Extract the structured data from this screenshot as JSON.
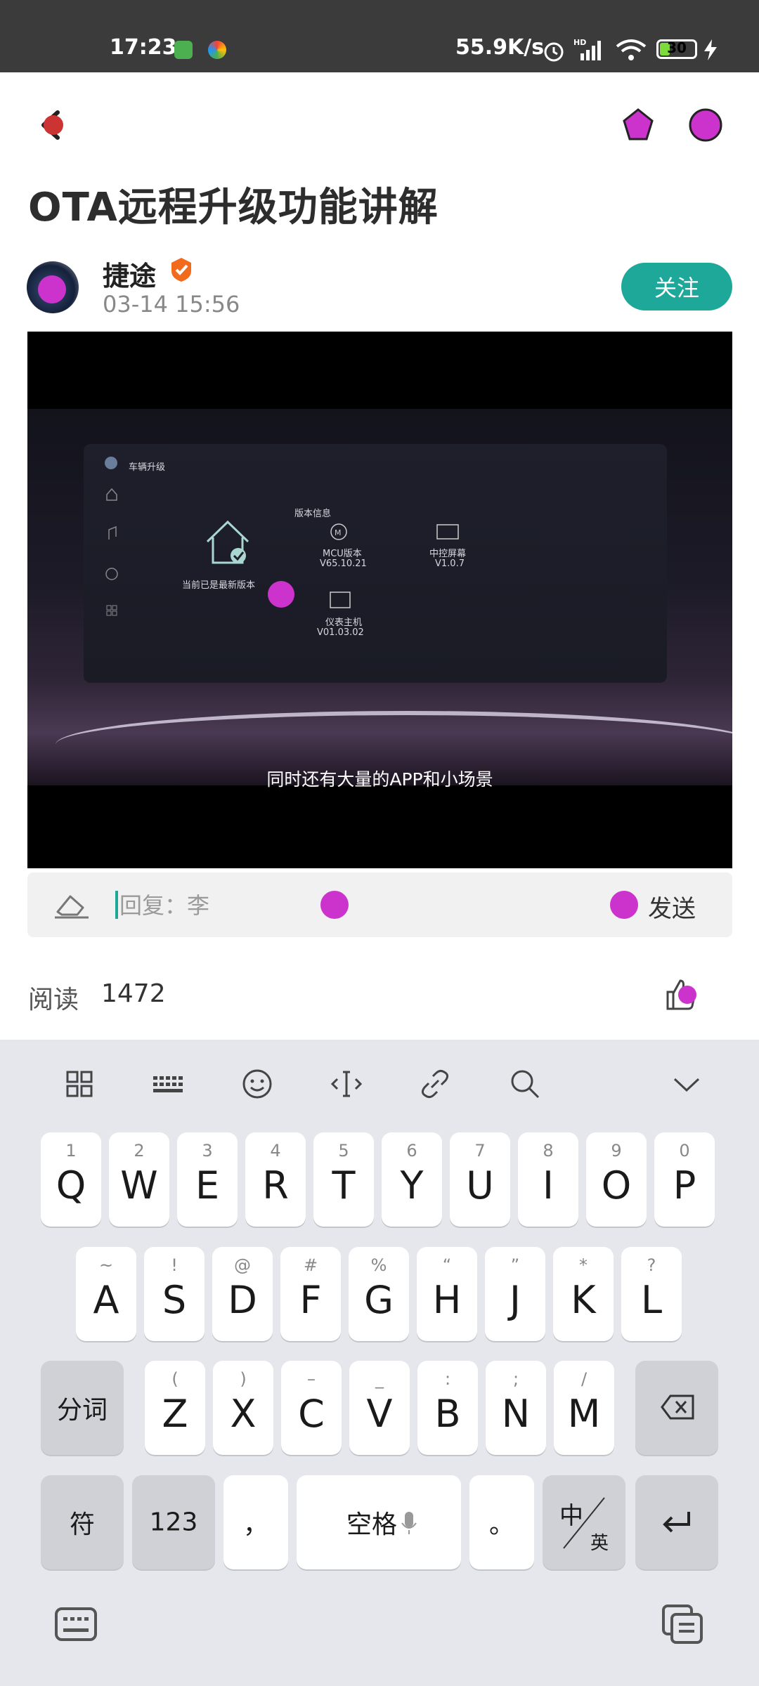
{
  "status_bar": {
    "time": "17:23",
    "network_speed": "55.9K/s",
    "battery": "30",
    "battery_level": 0.3,
    "icons": [
      "app-notification-icon",
      "app-colorful-icon",
      "alarm-icon",
      "hd-signal-icon",
      "wifi-icon",
      "battery-icon",
      "charging-icon"
    ]
  },
  "header": {
    "back_icon": "back-arrow-icon",
    "share_icon": "share-icon",
    "more_icon": "more-icon"
  },
  "article": {
    "title": "OTA远程升级功能讲解",
    "author": "捷途",
    "post_time": "03-14 15:56",
    "follow_label": "关注"
  },
  "video": {
    "subtitle": "同时还有大量的APP和小场景",
    "screen": {
      "header": "车辆升级",
      "version_title": "版本信息",
      "status": "当前已是最新版本",
      "mcu_label": "MCU版本",
      "mcu_version": "V65.10.21",
      "center_label": "中控屏幕",
      "center_version": "V1.0.7",
      "cluster_label": "仪表主机",
      "cluster_version": "V01.03.02"
    }
  },
  "reply": {
    "placeholder": "回复：李",
    "send_label": "发送"
  },
  "stats": {
    "read_label": "阅读",
    "read_count": "1472"
  },
  "keyboard": {
    "toolbar": [
      "grid-apps-icon",
      "keyboard-layout-icon",
      "emoji-icon",
      "cursor-move-icon",
      "link-icon",
      "search-icon",
      "collapse-chevron-icon"
    ],
    "row1": [
      {
        "main": "Q",
        "sub": "1"
      },
      {
        "main": "W",
        "sub": "2"
      },
      {
        "main": "E",
        "sub": "3"
      },
      {
        "main": "R",
        "sub": "4"
      },
      {
        "main": "T",
        "sub": "5"
      },
      {
        "main": "Y",
        "sub": "6"
      },
      {
        "main": "U",
        "sub": "7"
      },
      {
        "main": "I",
        "sub": "8"
      },
      {
        "main": "O",
        "sub": "9"
      },
      {
        "main": "P",
        "sub": "0"
      }
    ],
    "row2": [
      {
        "main": "A",
        "sub": "~"
      },
      {
        "main": "S",
        "sub": "!"
      },
      {
        "main": "D",
        "sub": "@"
      },
      {
        "main": "F",
        "sub": "#"
      },
      {
        "main": "G",
        "sub": "%"
      },
      {
        "main": "H",
        "sub": "“"
      },
      {
        "main": "J",
        "sub": "”"
      },
      {
        "main": "K",
        "sub": "*"
      },
      {
        "main": "L",
        "sub": "?"
      }
    ],
    "row3": [
      {
        "main": "Z",
        "sub": "("
      },
      {
        "main": "X",
        "sub": ")"
      },
      {
        "main": "C",
        "sub": "–"
      },
      {
        "main": "V",
        "sub": "_"
      },
      {
        "main": "B",
        "sub": ":"
      },
      {
        "main": "N",
        "sub": ";"
      },
      {
        "main": "M",
        "sub": "/"
      }
    ],
    "segment_label": "分词",
    "symbol_label": "符",
    "number_label": "123",
    "comma_label": "，",
    "space_label": "空格",
    "period_label": "。",
    "lang_top": "中",
    "lang_bottom": "英",
    "bottom_left_icon": "keyboard-switch-icon",
    "bottom_right_icon": "clipboard-icon"
  }
}
